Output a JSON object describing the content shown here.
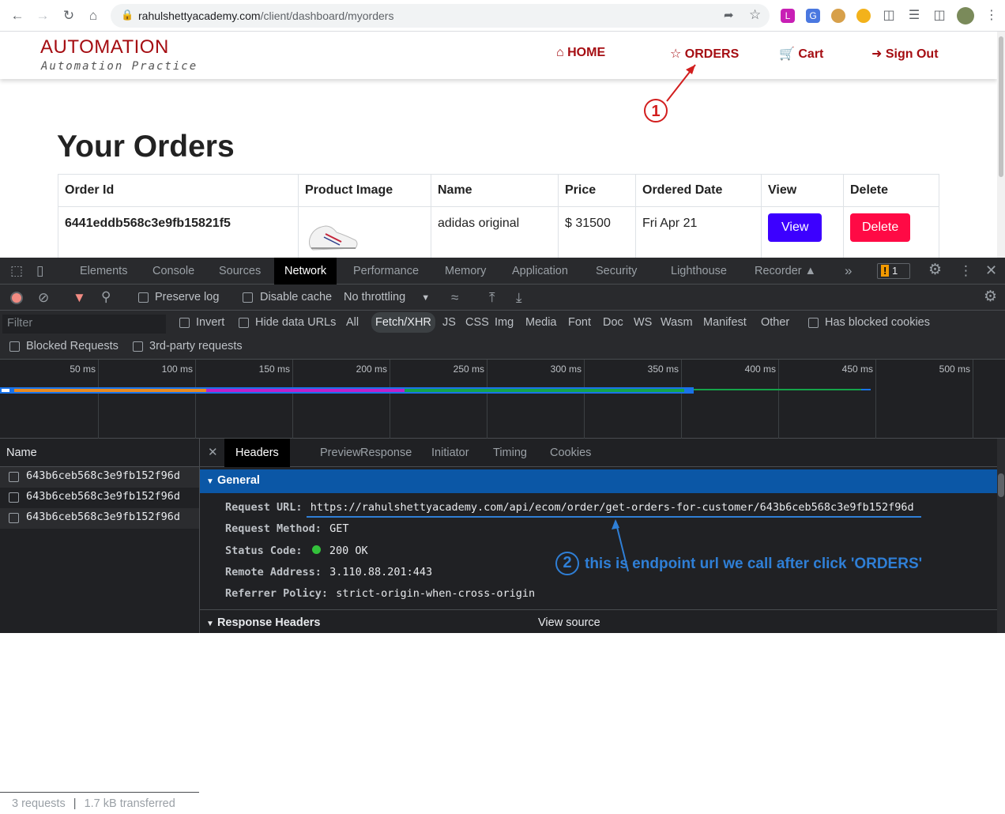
{
  "browser": {
    "url_host": "rahulshettyacademy.com",
    "url_path": "/client/dashboard/myorders"
  },
  "site": {
    "brand_title": "AUTOMATION",
    "brand_subtitle": "Automation Practice",
    "nav": {
      "home": "HOME",
      "orders": "ORDERS",
      "cart": "Cart",
      "signout": "Sign Out"
    },
    "page_title": "Your Orders",
    "table": {
      "headers": [
        "Order Id",
        "Product Image",
        "Name",
        "Price",
        "Ordered Date",
        "View",
        "Delete"
      ],
      "rows": [
        {
          "order_id": "6441eddb568c3e9fb15821f5",
          "name": "adidas original",
          "price": "$ 31500",
          "date": "Fri Apr 21",
          "view": "View",
          "delete": "Delete"
        }
      ]
    }
  },
  "devtools": {
    "tabs": [
      "Elements",
      "Console",
      "Sources",
      "Network",
      "Performance",
      "Memory",
      "Application",
      "Security",
      "Lighthouse",
      "Recorder"
    ],
    "active_tab": "Network",
    "issues_count": "1",
    "toolbar": {
      "preserve_log": "Preserve log",
      "disable_cache": "Disable cache",
      "throttling": "No throttling"
    },
    "filter": {
      "placeholder": "Filter",
      "invert": "Invert",
      "hide_data_urls": "Hide data URLs",
      "types": [
        "All",
        "Fetch/XHR",
        "JS",
        "CSS",
        "Img",
        "Media",
        "Font",
        "Doc",
        "WS",
        "Wasm",
        "Manifest",
        "Other"
      ],
      "selected_type": "Fetch/XHR",
      "has_blocked_cookies": "Has blocked cookies",
      "blocked_requests": "Blocked Requests",
      "third_party": "3rd-party requests"
    },
    "timeline_ticks": [
      "50 ms",
      "100 ms",
      "150 ms",
      "200 ms",
      "250 ms",
      "300 ms",
      "350 ms",
      "400 ms",
      "450 ms",
      "500 ms"
    ],
    "name_header": "Name",
    "requests": [
      "643b6ceb568c3e9fb152f96d",
      "643b6ceb568c3e9fb152f96d",
      "643b6ceb568c3e9fb152f96d"
    ],
    "status": {
      "requests": "3 requests",
      "transferred": "1.7 kB transferred"
    },
    "detail_tabs": [
      "Headers",
      "Preview",
      "Response",
      "Initiator",
      "Timing",
      "Cookies"
    ],
    "general_title": "General",
    "general": {
      "request_url_label": "Request URL:",
      "request_url": "https://rahulshettyacademy.com/api/ecom/order/get-orders-for-customer/643b6ceb568c3e9fb152f96d",
      "method_label": "Request Method:",
      "method": "GET",
      "status_label": "Status Code:",
      "status": "200 OK",
      "remote_label": "Remote Address:",
      "remote": "3.110.88.201:443",
      "referrer_label": "Referrer Policy:",
      "referrer": "strict-origin-when-cross-origin"
    },
    "response_headers_title": "Response Headers",
    "view_source": "View source"
  },
  "annotations": {
    "one_number": "1",
    "two_number": "2",
    "two_text": "this is endpoint url we call after click 'ORDERS'"
  },
  "colors": {
    "brand": "#a50d12",
    "view_button": "#3c00ff",
    "delete_button": "#ff0a45",
    "annotation_red": "#d21e1e",
    "annotation_blue": "#2f7fd6"
  }
}
